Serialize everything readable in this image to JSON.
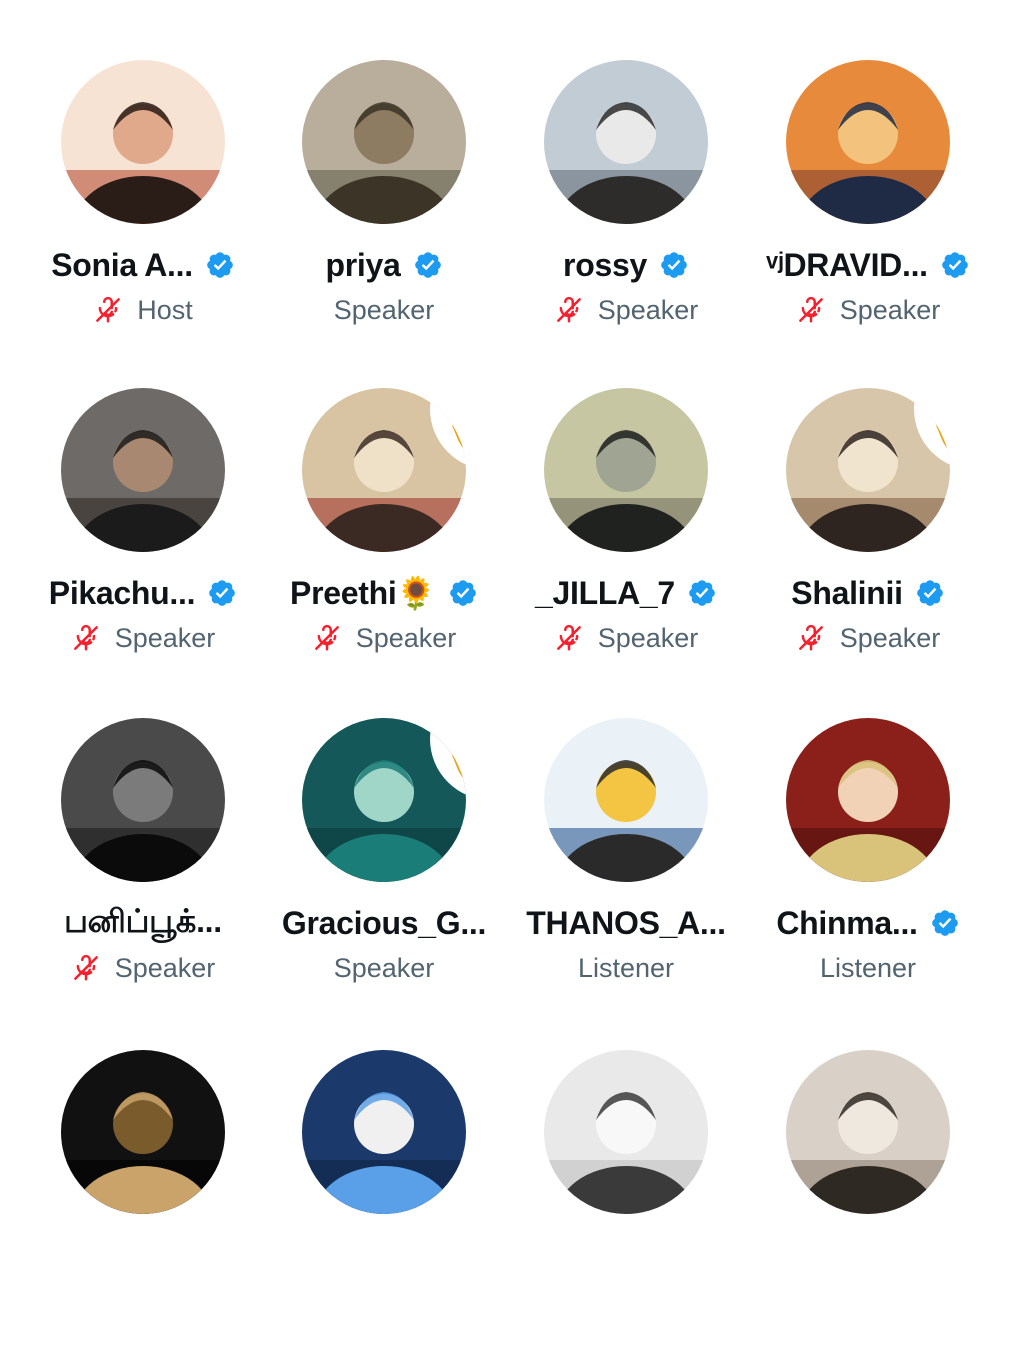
{
  "participants": [
    {
      "name": "Sonia A...",
      "verified": true,
      "role": "Host",
      "muted": true,
      "hand_raised": false
    },
    {
      "name": "priya",
      "verified": true,
      "role": "Speaker",
      "muted": false,
      "hand_raised": false
    },
    {
      "name": "rossy",
      "verified": true,
      "role": "Speaker",
      "muted": true,
      "hand_raised": false
    },
    {
      "name": "ᵛʲDRAVID...",
      "verified": true,
      "role": "Speaker",
      "muted": true,
      "hand_raised": false
    },
    {
      "name": "Pikachu...",
      "verified": true,
      "role": "Speaker",
      "muted": true,
      "hand_raised": false
    },
    {
      "name": "Preethi🌻",
      "verified": true,
      "role": "Speaker",
      "muted": true,
      "hand_raised": true
    },
    {
      "name": "_JILLA_7",
      "verified": true,
      "role": "Speaker",
      "muted": true,
      "hand_raised": false
    },
    {
      "name": "Shalinii",
      "verified": true,
      "role": "Speaker",
      "muted": true,
      "hand_raised": true
    },
    {
      "name": "பனிப்பூக்...",
      "verified": false,
      "role": "Speaker",
      "muted": true,
      "hand_raised": false
    },
    {
      "name": "Gracious_G...",
      "verified": false,
      "role": "Speaker",
      "muted": false,
      "hand_raised": true
    },
    {
      "name": "THANOS_A...",
      "verified": false,
      "role": "Listener",
      "muted": false,
      "hand_raised": false
    },
    {
      "name": "Chinma...",
      "verified": true,
      "role": "Listener",
      "muted": false,
      "hand_raised": false
    },
    {
      "name": "",
      "verified": false,
      "role": "",
      "muted": false,
      "hand_raised": false
    },
    {
      "name": "",
      "verified": false,
      "role": "",
      "muted": false,
      "hand_raised": false
    },
    {
      "name": "",
      "verified": false,
      "role": "",
      "muted": false,
      "hand_raised": false
    },
    {
      "name": "",
      "verified": false,
      "role": "",
      "muted": false,
      "hand_raised": false
    }
  ],
  "colors": {
    "verified_badge": "#1d9bf0",
    "muted_mic": "#f4212e",
    "name_text": "#0f1419",
    "role_text": "#536471",
    "raised_hand": "#ffcc4d"
  },
  "icons": {
    "verified": "verified-badge-icon",
    "muted": "mic-muted-icon",
    "hand": "raised-hand-icon"
  }
}
